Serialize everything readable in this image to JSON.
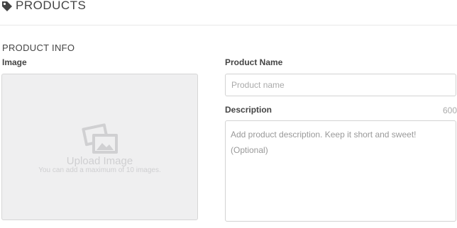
{
  "header": {
    "title": "PRODUCTS",
    "icon": "tag-icon"
  },
  "section": {
    "title": "PRODUCT INFO"
  },
  "image_field": {
    "label": "Image",
    "upload_label": "Upload Image",
    "upload_hint": "You can add a maximum of 10 images.",
    "icon": "image-icon"
  },
  "name_field": {
    "label": "Product Name",
    "placeholder": "Product name",
    "value": ""
  },
  "description_field": {
    "label": "Description",
    "counter": "600",
    "placeholder": "Add product description. Keep it short and sweet!\n(Optional)",
    "value": ""
  },
  "colors": {
    "accent": "#444444",
    "upload_bg": "#efeff0",
    "muted": "#cfcfd1"
  }
}
